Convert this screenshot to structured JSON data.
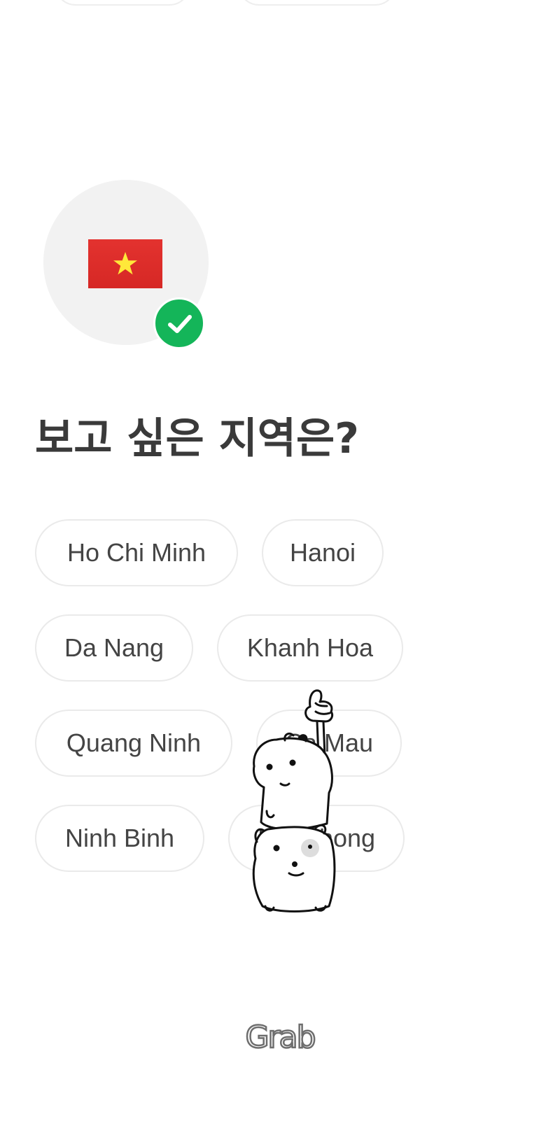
{
  "heading": "보고 싶은 지역은?",
  "country": {
    "flag_icon": "vietnam-flag-icon",
    "selected_icon": "check-icon",
    "accent_color": "#14b559"
  },
  "regions": [
    {
      "label": "Ho Chi Minh"
    },
    {
      "label": "Hanoi"
    },
    {
      "label": "Da Nang"
    },
    {
      "label": "Khanh Hoa"
    },
    {
      "label": "Quang Ninh"
    },
    {
      "label": "Ca Mau"
    },
    {
      "label": "Ninh Binh"
    },
    {
      "label": "Hai Phong"
    }
  ],
  "footer": {
    "brand": "Grab"
  }
}
